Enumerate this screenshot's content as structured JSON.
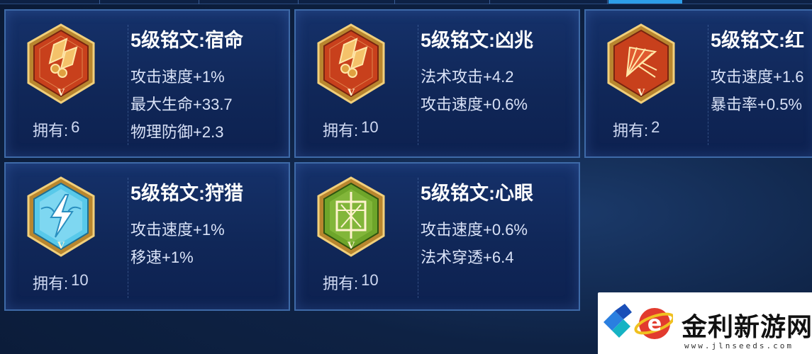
{
  "runes": [
    {
      "title": "5级铭文:宿命",
      "stats": [
        "攻击速度+1%",
        "最大生命+33.7",
        "物理防御+2.3"
      ],
      "owned_label": "拥有:",
      "owned_count": "6",
      "tier": "V",
      "color": "red",
      "icon": "crystal-rune-icon"
    },
    {
      "title": "5级铭文:凶兆",
      "stats": [
        "法术攻击+4.2",
        "攻击速度+0.6%"
      ],
      "owned_label": "拥有:",
      "owned_count": "10",
      "tier": "V",
      "color": "red",
      "icon": "crystal-rune-icon"
    },
    {
      "title": "5级铭文:红",
      "stats": [
        "攻击速度+1.6",
        "暴击率+0.5%"
      ],
      "owned_label": "拥有:",
      "owned_count": "2",
      "tier": "V",
      "color": "red",
      "icon": "fan-rune-icon"
    },
    {
      "title": "5级铭文:狩猎",
      "stats": [
        "攻击速度+1%",
        "移速+1%"
      ],
      "owned_label": "拥有:",
      "owned_count": "10",
      "tier": "V",
      "color": "blue",
      "icon": "lightning-rune-icon"
    },
    {
      "title": "5级铭文:心眼",
      "stats": [
        "攻击速度+0.6%",
        "法术穿透+6.4"
      ],
      "owned_label": "拥有:",
      "owned_count": "10",
      "tier": "V",
      "color": "green",
      "icon": "eye-rune-icon"
    }
  ],
  "watermark": {
    "name": "金利新游网",
    "url": "www.jlnseeds.com"
  },
  "colors": {
    "red_gem": "#c8401c",
    "blue_gem": "#58c9ea",
    "green_gem": "#6ea52a",
    "gold_frame": "#d9a84a",
    "tab_active": "#2d9ee8"
  }
}
